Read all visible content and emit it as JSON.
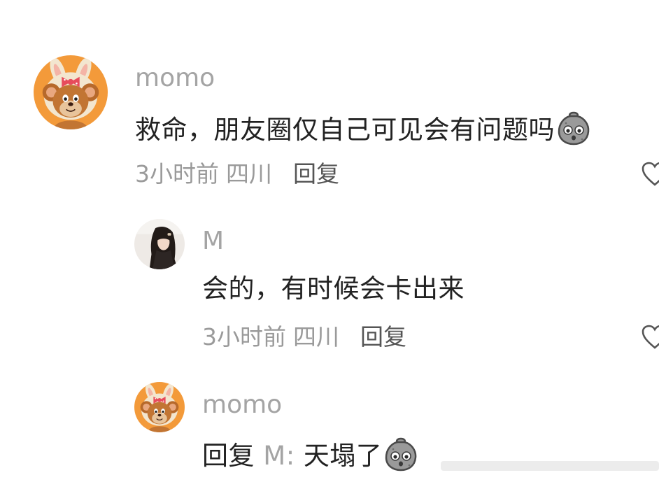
{
  "comments": [
    {
      "username": "momo",
      "text": "救命，朋友圈仅自己可见会有问题吗",
      "emoji": "sad-potato-emoji",
      "time": "3小时前",
      "location": "四川",
      "reply_label": "回复",
      "avatar_icon": "jerry-mouse-bunny-avatar"
    },
    {
      "username": "M",
      "text": "会的，有时候会卡出来",
      "time": "3小时前",
      "location": "四川",
      "reply_label": "回复",
      "avatar_icon": "girl-photo-avatar"
    },
    {
      "username": "momo",
      "reply_prefix": "回复",
      "reply_to": "M:",
      "text": "天塌了",
      "emoji": "sad-potato-emoji",
      "avatar_icon": "jerry-mouse-bunny-avatar"
    }
  ],
  "colors": {
    "username": "#a4a4a4",
    "text": "#222222",
    "meta": "#9a9a9a",
    "avatar_bg": "#f28c2e"
  }
}
